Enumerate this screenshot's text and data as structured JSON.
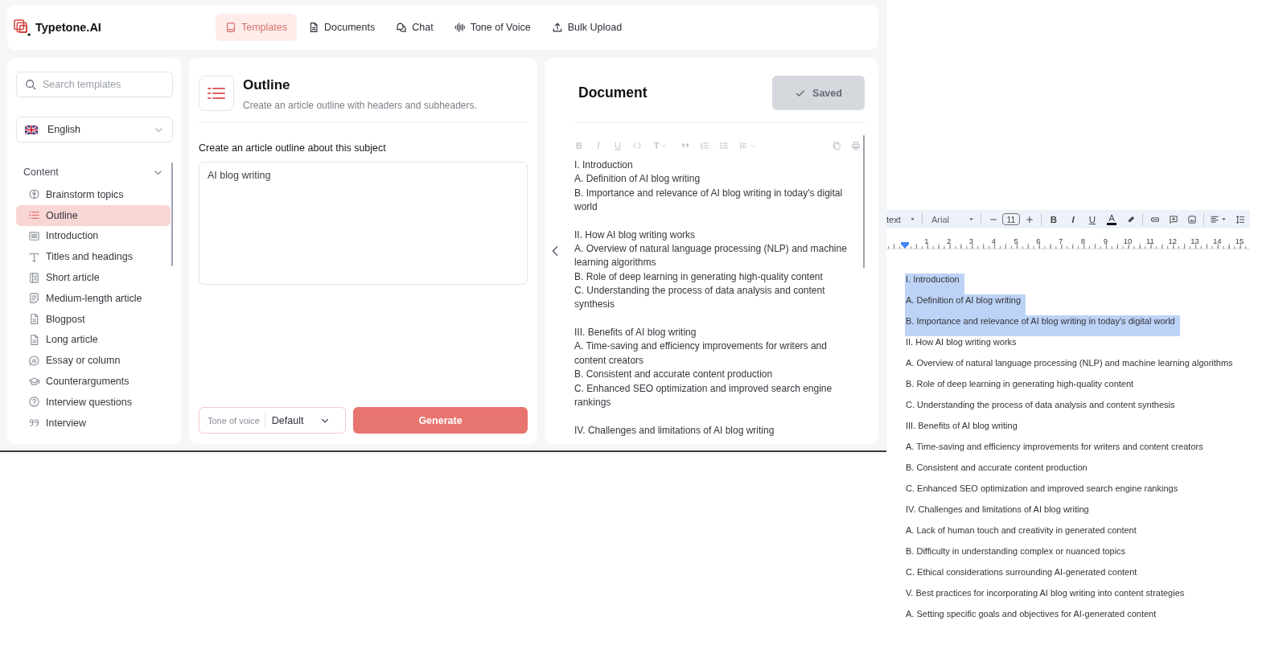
{
  "app": {
    "logo": {
      "name": "Typetone.AI"
    },
    "nav": [
      {
        "label": "Templates",
        "selected": true
      },
      {
        "label": "Documents",
        "selected": false
      },
      {
        "label": "Chat",
        "selected": false
      },
      {
        "label": "Tone of Voice",
        "selected": false
      },
      {
        "label": "Bulk Upload",
        "selected": false
      }
    ],
    "sidebar": {
      "search": {
        "placeholder": "Search templates"
      },
      "language": {
        "value": "English"
      },
      "section": {
        "title": "Content",
        "expanded": true,
        "items": [
          {
            "label": "Brainstorm topics",
            "selected": false
          },
          {
            "label": "Outline",
            "selected": true
          },
          {
            "label": "Introduction",
            "selected": false
          },
          {
            "label": "Titles and headings",
            "selected": false
          },
          {
            "label": "Short article",
            "selected": false
          },
          {
            "label": "Medium-length article",
            "selected": false
          },
          {
            "label": "Blogpost",
            "selected": false
          },
          {
            "label": "Long article",
            "selected": false
          },
          {
            "label": "Essay or column",
            "selected": false
          },
          {
            "label": "Counterarguments",
            "selected": false
          },
          {
            "label": "Interview questions",
            "selected": false
          },
          {
            "label": "Interview",
            "selected": false
          }
        ]
      }
    },
    "template": {
      "title": "Outline",
      "description": "Create an article outline with headers and subheaders.",
      "prompt_label": "Create an article outline about this subject",
      "prompt": {
        "value": "AI blog writing"
      },
      "tone": {
        "label": "Tone of voice",
        "value": "Default"
      },
      "generate_button": {
        "label": "Generate"
      }
    },
    "document": {
      "title": "Document",
      "save_button": {
        "label": "Saved",
        "disabled": true
      },
      "toolbar": [
        {
          "kind": "bold",
          "label": "B"
        },
        {
          "kind": "italic",
          "label": "I"
        },
        {
          "kind": "underline",
          "label": "U"
        },
        {
          "kind": "code"
        },
        {
          "kind": "heading",
          "label": "T"
        },
        {
          "kind": "quote"
        },
        {
          "kind": "ordered-list"
        },
        {
          "kind": "bullet-list"
        },
        {
          "kind": "align"
        }
      ],
      "sections": [
        {
          "lines": [
            "I. Introduction",
            "A. Definition of AI blog writing",
            "B. Importance and relevance of AI blog writing in today's digital world"
          ]
        },
        {
          "lines": [
            "II. How AI blog writing works",
            "A. Overview of natural language processing (NLP) and machine learning algorithms",
            "B. Role of deep learning in generating high-quality content",
            "C. Understanding the process of data analysis and content synthesis"
          ]
        },
        {
          "lines": [
            "III. Benefits of AI blog writing",
            "A. Time-saving and efficiency improvements for writers and content creators",
            "B. Consistent and accurate content production",
            "C. Enhanced SEO optimization and improved search engine rankings"
          ]
        },
        {
          "lines": [
            "IV. Challenges and limitations of AI blog writing"
          ]
        }
      ]
    }
  },
  "docs_editor": {
    "toolbar": {
      "style": "text",
      "font": "Arial",
      "font_size": "11",
      "format": [
        {
          "kind": "bold",
          "label": "B"
        },
        {
          "kind": "italic",
          "label": "I"
        },
        {
          "kind": "underline",
          "label": "U"
        },
        {
          "kind": "text-color",
          "label": "A"
        }
      ]
    },
    "ruler": [
      "1",
      "2",
      "3",
      "4",
      "5",
      "6",
      "7",
      "8",
      "9",
      "10",
      "11",
      "12",
      "13",
      "14",
      "15"
    ],
    "lines": [
      {
        "text": "I. Introduction",
        "selected": true
      },
      {
        "text": "A. Definition of AI blog writing",
        "selected": true
      },
      {
        "text": "B. Importance and relevance of AI blog writing in today's digital world",
        "selected": true
      },
      {
        "text": "II. How AI blog writing works",
        "selected": false
      },
      {
        "text": "A. Overview of natural language processing (NLP) and machine learning algorithms",
        "selected": false
      },
      {
        "text": "B. Role of deep learning in generating high-quality content",
        "selected": false
      },
      {
        "text": "C. Understanding the process of data analysis and content synthesis",
        "selected": false
      },
      {
        "text": "III. Benefits of AI blog writing",
        "selected": false
      },
      {
        "text": "A. Time-saving and efficiency improvements for writers and content creators",
        "selected": false
      },
      {
        "text": "B. Consistent and accurate content production",
        "selected": false
      },
      {
        "text": "C. Enhanced SEO optimization and improved search engine rankings",
        "selected": false
      },
      {
        "text": "IV. Challenges and limitations of AI blog writing",
        "selected": false
      },
      {
        "text": "A. Lack of human touch and creativity in generated content",
        "selected": false
      },
      {
        "text": "B. Difficulty in understanding complex or nuanced topics",
        "selected": false
      },
      {
        "text": "C. Ethical considerations surrounding AI-generated content",
        "selected": false
      },
      {
        "text": "V. Best practices for incorporating AI blog writing into content strategies",
        "selected": false
      },
      {
        "text": "A. Setting specific goals and objectives for AI-generated content",
        "selected": false
      }
    ]
  }
}
